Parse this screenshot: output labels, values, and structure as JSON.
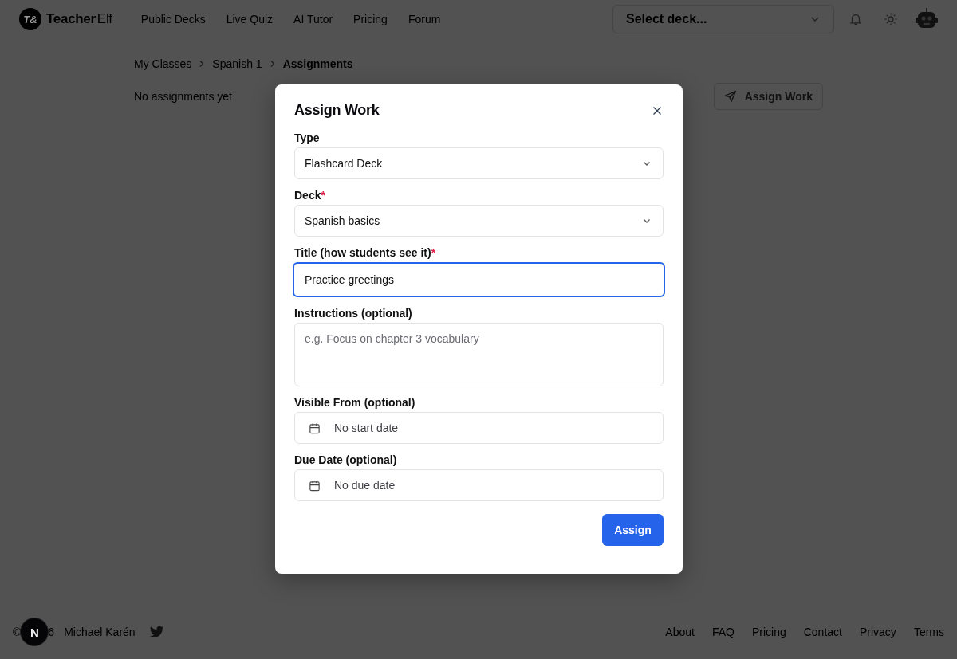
{
  "header": {
    "logo_mark": "T&",
    "brand": "Teacher",
    "brand_suffix": "Elf",
    "nav": [
      "Public Decks",
      "Live Quiz",
      "AI Tutor",
      "Pricing",
      "Forum"
    ],
    "deck_select": {
      "placeholder": "Select deck..."
    }
  },
  "breadcrumb": [
    {
      "label": "My Classes",
      "current": false
    },
    {
      "label": "Spanish 1",
      "current": false
    },
    {
      "label": "Assignments",
      "current": true
    }
  ],
  "empty_message": "No assignments yet",
  "assign_button": "Assign Work",
  "dialog": {
    "title": "Assign Work",
    "fields": [
      {
        "kind": "select",
        "label": "Type",
        "value": "Flashcard Deck",
        "focused": false
      },
      {
        "kind": "select",
        "label": "Deck",
        "required_mark": "*",
        "value": "Spanish basics",
        "focused": false
      },
      {
        "kind": "text",
        "label": "Title (how students see it)",
        "required_mark": "*",
        "value": "Practice greetings",
        "focused": true
      },
      {
        "kind": "textarea",
        "label": "Instructions (optional)",
        "placeholder": "e.g. Focus on chapter 3 vocabulary",
        "focused": false
      },
      {
        "kind": "date",
        "label": "Visible From (optional)",
        "placeholder": "No start date",
        "focused": false
      },
      {
        "kind": "date",
        "label": "Due Date (optional)",
        "placeholder": "No due date",
        "focused": false
      }
    ],
    "submit": "Assign"
  },
  "footer": {
    "copyright_parts": [
      "©",
      "6"
    ],
    "badge": "N",
    "author": "Michael Karén",
    "links": [
      "About",
      "FAQ",
      "Pricing",
      "Contact",
      "Privacy",
      "Terms"
    ]
  }
}
